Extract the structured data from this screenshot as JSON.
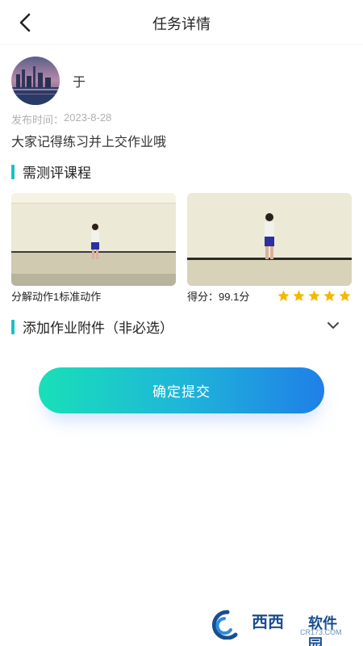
{
  "header": {
    "title": "任务详情"
  },
  "author": {
    "name": "于"
  },
  "task": {
    "publish_label": "发布时间：",
    "publish_date": "2023-8-28",
    "description": "大家记得练习并上交作业哦"
  },
  "courses_section": {
    "title": "需测评课程"
  },
  "course_cards": [
    {
      "label": "分解动作1标准动作"
    },
    {
      "score_label": "得分：",
      "score_value": "99.1分",
      "stars": 5
    }
  ],
  "attachment_section": {
    "title": "添加作业附件（非必选）"
  },
  "submit": {
    "label": "确定提交"
  },
  "watermark": {
    "brand": "西西",
    "sub": "软件园",
    "url": "CR173.COM"
  },
  "colors": {
    "accent": "#19c2c2",
    "star": "#f5b800",
    "gradient_start": "#18e0b8",
    "gradient_end": "#1f7fe8"
  },
  "icons": {
    "back": "chevron-left-icon",
    "expand": "chevron-down-icon",
    "rating": "star-icon"
  }
}
